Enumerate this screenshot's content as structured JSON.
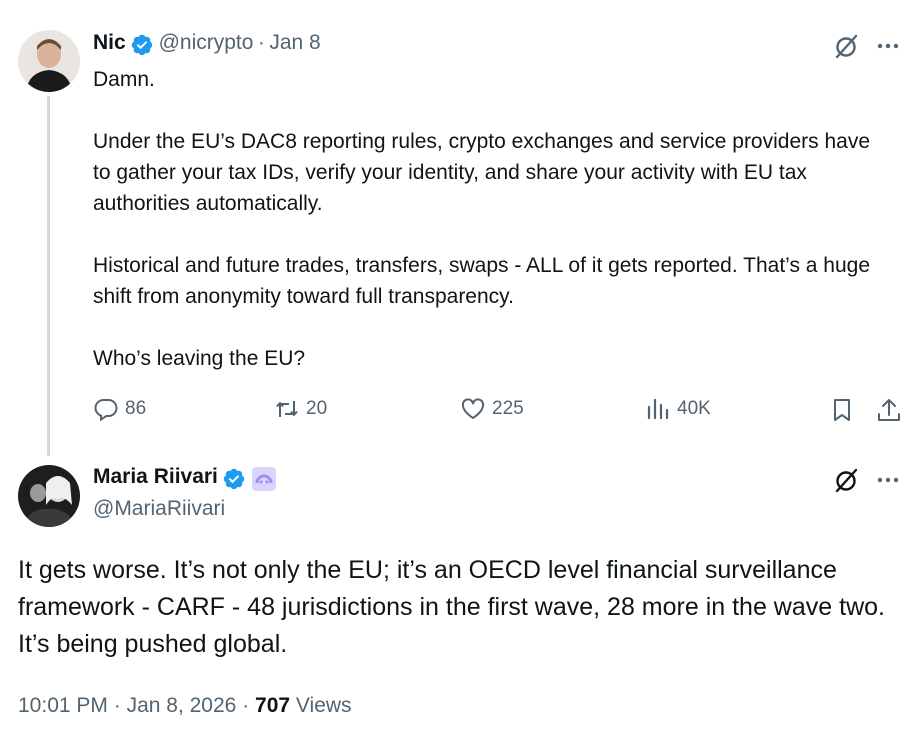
{
  "colors": {
    "text": "#0f1419",
    "secondary": "#536471",
    "verified": "#1d9bf0",
    "thread_line": "#cfd9de",
    "affiliate_badge": "#9b8ff0"
  },
  "tweet": {
    "author_name": "Nic",
    "author_handle": "@nicrypto",
    "separator": "·",
    "date": "Jan 8",
    "text": "Damn.\n\nUnder the EU’s DAC8 reporting rules, crypto exchanges and service providers have to gather your tax IDs, verify your identity, and share your activity with EU tax authorities automatically.\n\nHistorical and future trades, transfers, swaps - ALL of it gets reported. That’s a huge shift from anonymity toward full transparency.\n\nWho’s leaving the EU?",
    "replies": "86",
    "reposts": "20",
    "likes": "225",
    "views": "40K",
    "icons": [
      "grok-icon",
      "more-icon",
      "reply-icon",
      "repost-icon",
      "like-icon",
      "views-icon",
      "bookmark-icon",
      "share-icon",
      "verified-icon"
    ]
  },
  "reply": {
    "author_name": "Maria Riivari",
    "author_handle": "@MariaRiivari",
    "text": "It gets worse. It’s not only the EU; it’s an OECD level financial surveillance framework - CARF - 48 jurisdictions in the first wave, 28 more in the wave two. It’s being pushed global.",
    "time": "10:01 PM",
    "date": "Jan 8, 2026",
    "separator": "·",
    "views_count": "707",
    "views_label": "Views",
    "icons": [
      "grok-icon",
      "more-icon",
      "verified-icon",
      "affiliate-badge-icon"
    ]
  }
}
